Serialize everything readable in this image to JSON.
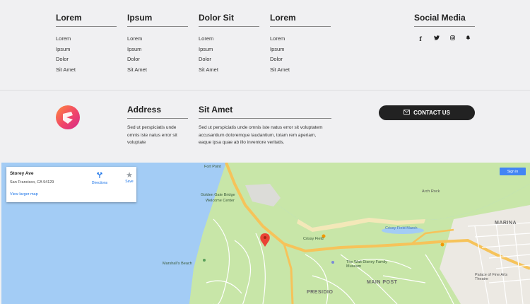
{
  "footer": {
    "columns": [
      {
        "heading": "Lorem",
        "items": [
          "Lorem",
          "Ipsum",
          "Dolor",
          "Sit Amet"
        ]
      },
      {
        "heading": "Ipsum",
        "items": [
          "Lorem",
          "Ipsum",
          "Dolor",
          "Sit Amet"
        ]
      },
      {
        "heading": "Dolor Sit",
        "items": [
          "Lorem",
          "Ipsum",
          "Dolor",
          "Sit Amet"
        ]
      },
      {
        "heading": "Lorem",
        "items": [
          "Lorem",
          "Ipsum",
          "Dolor",
          "Sit Amet"
        ]
      }
    ],
    "social": {
      "heading": "Social Media",
      "icons": [
        {
          "name": "facebook-icon",
          "glyph": "f"
        },
        {
          "name": "twitter-icon",
          "glyph": "🐦"
        },
        {
          "name": "instagram-icon",
          "glyph": "◎"
        },
        {
          "name": "snapchat-icon",
          "glyph": "👻"
        }
      ]
    },
    "address": {
      "heading": "Address",
      "text": "Sed ut perspiciatis unde omnis iste natus error sit voluptate"
    },
    "sit_amet": {
      "heading": "Sit Amet",
      "text": "Sed ut perspiciatis unde omnis iste natus error sit voluptatem accusantium doloremque laudantium, totam rem aperiam, eaque ipsa quae ab illo inventore veritatis."
    },
    "contact_button": {
      "label": "CONTACT US",
      "icon": "envelope-icon"
    },
    "logo_colors": {
      "start": "#ff8a3d",
      "end": "#d42a8a"
    }
  },
  "map": {
    "place_card": {
      "name": "Storey Ave",
      "address": "San Francisco, CA 94129",
      "view_larger": "View larger map",
      "directions": "Directions",
      "save": "Save"
    },
    "signin": "Sign in",
    "labels": {
      "fort_point": "Fort Point",
      "golden_gate": "Golden Gate Bridge",
      "welcome_center": "Welcome Center",
      "arch_rock": "Arch Rock",
      "crissy_field": "Crissy Field",
      "crissy_marsh": "Crissy Field Marsh",
      "marshall_beach": "Marshall's Beach",
      "walt_disney": "The Walt Disney Family Museum",
      "presidio": "PRESIDIO",
      "main_post": "MAIN POST",
      "marina": "MARINA",
      "palace": "Palace of Fine Arts Theatre"
    },
    "colors": {
      "water": "#a3ccf5",
      "land": "#c8e6a8",
      "park": "#b7dc8f",
      "highway": "#f6c35a",
      "urban": "#ece9e3"
    }
  }
}
